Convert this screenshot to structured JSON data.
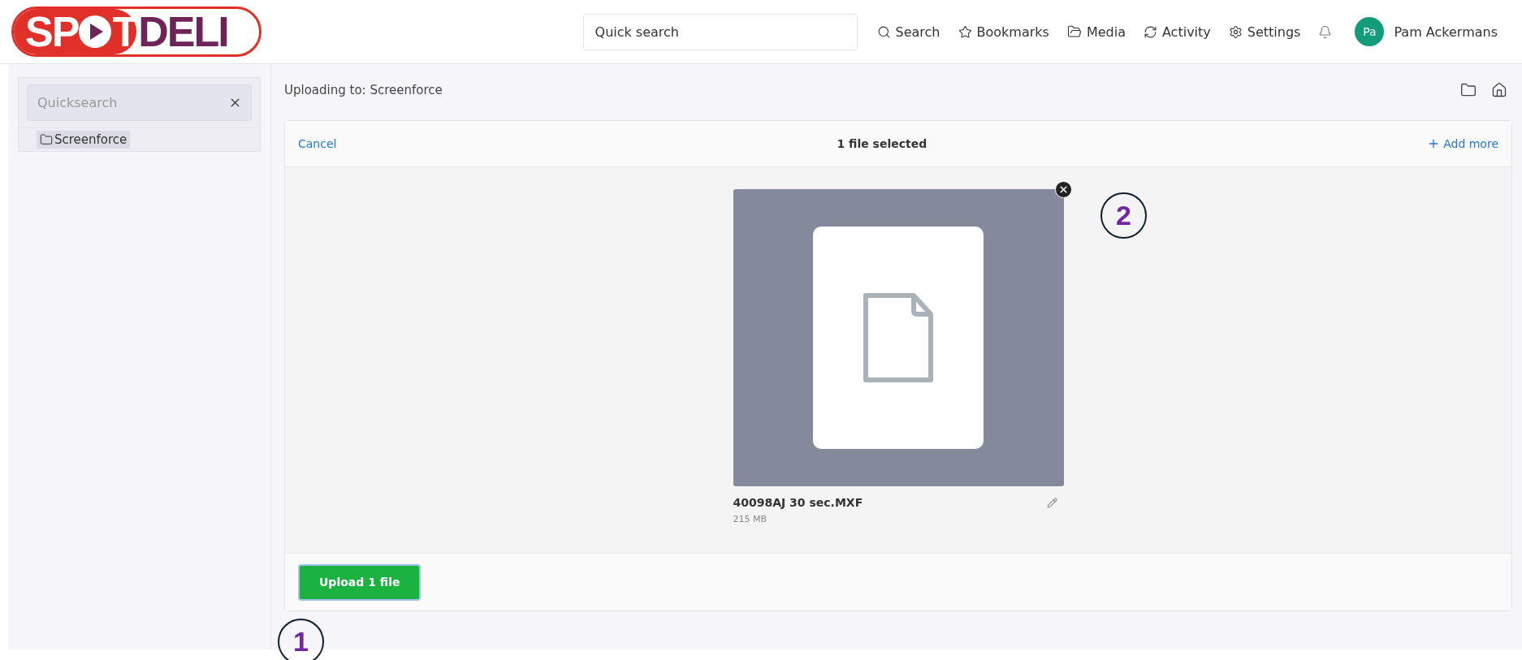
{
  "logo": {
    "before_icon": "SP",
    "after_icon": "T",
    "tail": "DELI"
  },
  "header": {
    "search": {
      "placeholder": "Quick search"
    },
    "nav": [
      {
        "kind": "search",
        "label": "Search"
      },
      {
        "kind": "bookmarks",
        "label": "Bookmarks"
      },
      {
        "kind": "media",
        "label": "Media"
      },
      {
        "kind": "activity",
        "label": "Activity"
      },
      {
        "kind": "settings",
        "label": "Settings"
      },
      {
        "kind": "notifications"
      }
    ],
    "user": {
      "initials": "Pa",
      "name": "Pam Ackermans"
    }
  },
  "sidebar": {
    "search": {
      "placeholder": "Quicksearch"
    },
    "tree": [
      {
        "label": "Screenforce",
        "selected": true
      }
    ]
  },
  "breadcrumb": "Uploading to: Screenforce",
  "uploader": {
    "cancel": "Cancel",
    "status": "1 file selected",
    "add_more": "Add more",
    "files": [
      {
        "name": "40098AJ 30 sec.MXF",
        "size": "215 MB"
      }
    ],
    "upload_button": "Upload 1 file"
  },
  "annotations": [
    {
      "label": "1",
      "kind": "bottom-left"
    },
    {
      "label": "2",
      "kind": "beside-file"
    }
  ]
}
